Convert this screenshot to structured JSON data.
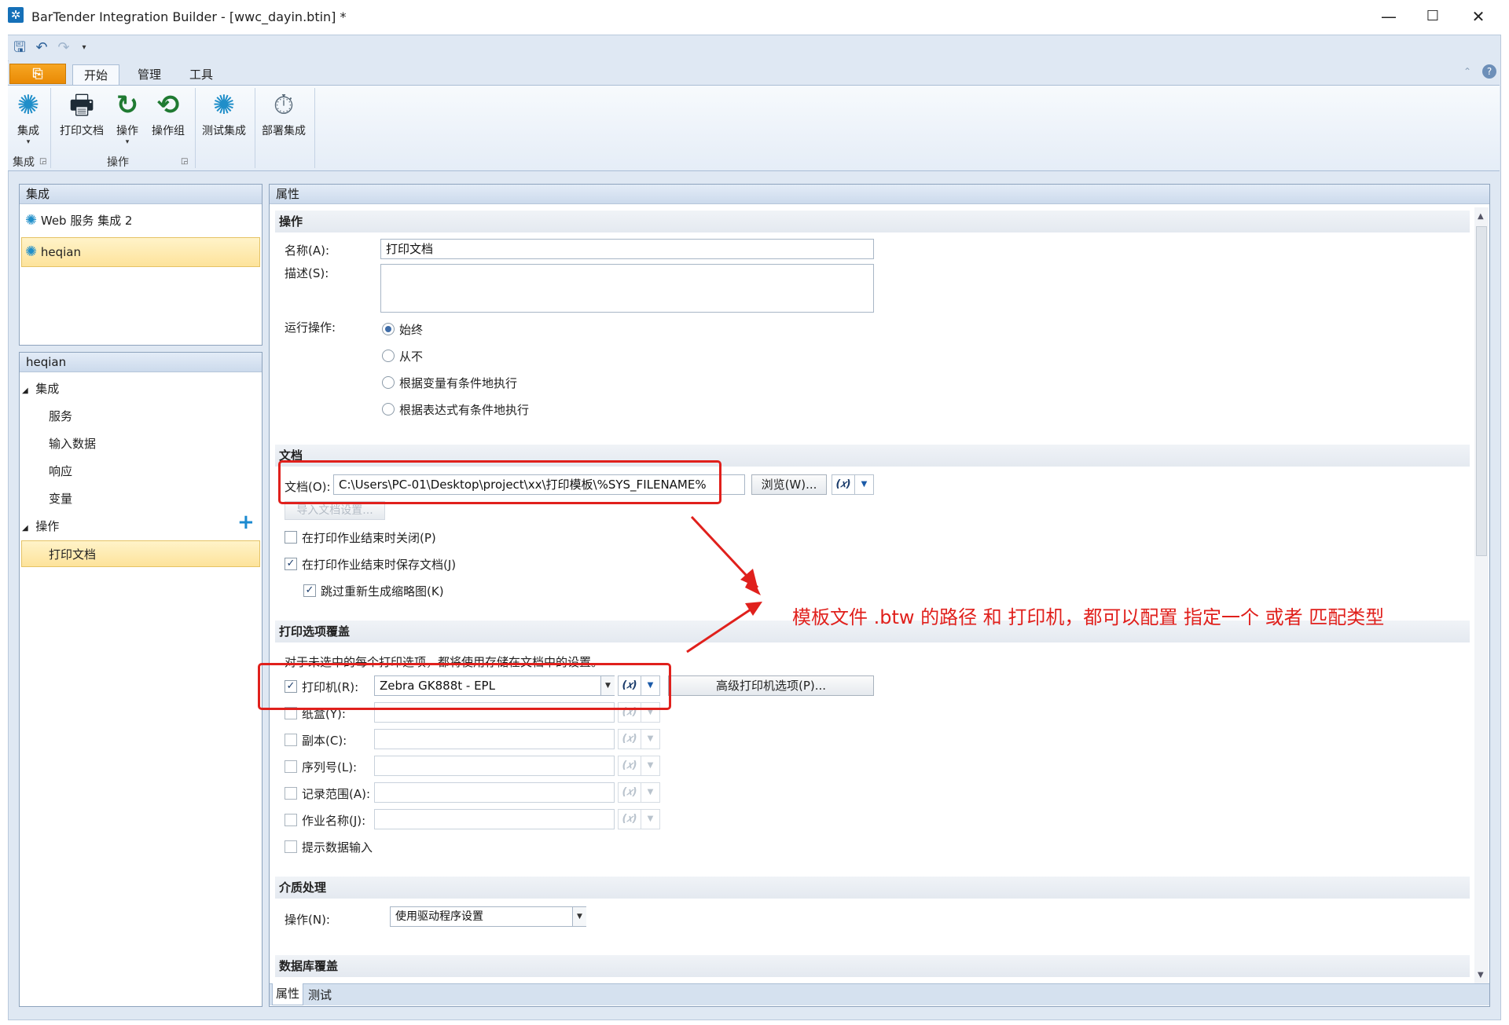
{
  "window": {
    "title": "BarTender Integration Builder - [wwc_dayin.btin] *",
    "minimize": "—",
    "maximize": "☐",
    "close": "✕"
  },
  "ribbon": {
    "tabs": [
      "开始",
      "管理",
      "工具"
    ],
    "buttons": {
      "integration": "集成",
      "print_doc": "打印文档",
      "action": "操作",
      "action_group": "操作组",
      "test": "测试集成",
      "deploy": "部署集成"
    },
    "groups": {
      "integration": "集成",
      "actions": "操作"
    }
  },
  "left": {
    "panel1": {
      "header": "集成",
      "items": [
        "Web 服务 集成 2",
        "heqian"
      ]
    },
    "panel2": {
      "header": "heqian",
      "tree": {
        "integration": "集成",
        "children": [
          "服务",
          "输入数据",
          "响应",
          "变量"
        ],
        "actions": "操作",
        "action_items": [
          "打印文档"
        ]
      }
    }
  },
  "props": {
    "header": "属性",
    "section_action": {
      "title": "操作",
      "name_label": "名称(A):",
      "name_value": "打印文档",
      "desc_label": "描述(S):",
      "desc_value": "",
      "run_label": "运行操作:",
      "run_options": [
        "始终",
        "从不",
        "根据变量有条件地执行",
        "根据表达式有条件地执行"
      ],
      "run_selected": "始终"
    },
    "section_doc": {
      "title": "文档",
      "doc_label": "文档(O):",
      "doc_value": "C:\\Users\\PC-01\\Desktop\\project\\xx\\打印模板\\%SYS_FILENAME%",
      "browse": "浏览(W)...",
      "import": "导入文档设置...",
      "close_after": "在打印作业结束时关闭(P)",
      "save_after": "在打印作业结束时保存文档(J)",
      "skip_thumb": "跳过重新生成缩略图(K)",
      "checked": {
        "close_after": false,
        "save_after": true,
        "skip_thumb": true
      }
    },
    "section_print": {
      "title": "打印选项覆盖",
      "note": "对于未选中的每个打印选项，都将使用存储在文档中的设置。",
      "printer_label": "打印机(R):",
      "printer_value": "Zebra GK888t - EPL",
      "advanced": "高级打印机选项(P)...",
      "other_labels": [
        "纸盒(Y):",
        "副本(C):",
        "序列号(L):",
        "记录范围(A):",
        "作业名称(J):"
      ],
      "prompt": "提示数据输入"
    },
    "section_media": {
      "title": "介质处理",
      "op_label": "操作(N):",
      "op_value": "使用驱动程序设置"
    },
    "section_db": {
      "title": "数据库覆盖"
    },
    "fx_label": "(𝑥)"
  },
  "bottom_tabs": [
    "属性",
    "测试"
  ],
  "annotation": {
    "text": "模板文件 .btw 的路径 和 打印机，都可以配置 指定一个 或者 匹配类型",
    "color": "#e0201c"
  }
}
